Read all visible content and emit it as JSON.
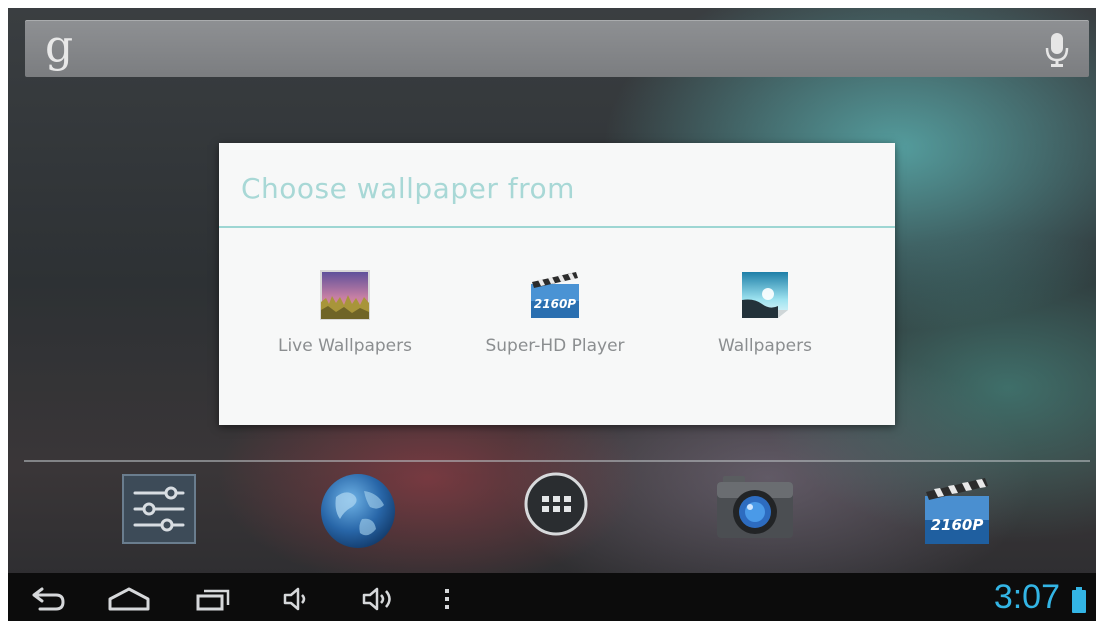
{
  "search": {
    "logo_text": "g",
    "mic_icon": "microphone-icon"
  },
  "dialog": {
    "title": "Choose wallpaper from",
    "options": [
      {
        "label": "Live Wallpapers",
        "icon": "live-wallpapers-icon"
      },
      {
        "label": "Super-HD Player",
        "icon": "super-hd-player-icon",
        "badge": "2160P"
      },
      {
        "label": "Wallpapers",
        "icon": "wallpapers-icon"
      }
    ]
  },
  "dock": {
    "items": [
      {
        "name": "settings-icon"
      },
      {
        "name": "browser-globe-icon"
      },
      {
        "name": "all-apps-icon"
      },
      {
        "name": "camera-icon"
      },
      {
        "name": "super-hd-player-icon",
        "badge": "2160P"
      }
    ]
  },
  "navbar": {
    "buttons": [
      "back-icon",
      "home-icon",
      "recent-apps-icon",
      "volume-down-icon",
      "volume-up-icon",
      "menu-icon"
    ],
    "clock": "3:07",
    "battery_icon": "battery-icon"
  },
  "colors": {
    "accent": "#33b5e5",
    "dialog_title": "#a8d8d6",
    "dialog_divider": "#9dd6d3"
  }
}
